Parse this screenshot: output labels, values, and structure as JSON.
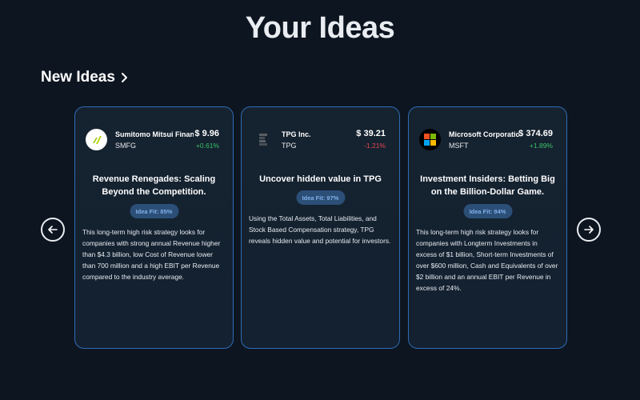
{
  "page": {
    "title": "Your Ideas"
  },
  "section": {
    "title": "New Ideas"
  },
  "colors": {
    "background": "#0d1520",
    "card_border": "#2e6cb5",
    "positive": "#3cc36a",
    "negative": "#e5484d",
    "badge_bg": "#2c4f78",
    "badge_text": "#7fb0e8"
  },
  "icons": {
    "section_chevron": "chevron-right-icon",
    "prev": "arrow-left-icon",
    "next": "arrow-right-icon"
  },
  "cards": [
    {
      "company": "Sumitomo Mitsui Financ",
      "ticker": "SMFG",
      "price": "$ 9.96",
      "change": "+0.61%",
      "change_direction": "up",
      "logo": "smfg-logo-icon",
      "title": "Revenue Renegades: Scaling Beyond the Competition.",
      "fit": "Idea Fit: 85%",
      "description": "This long-term high risk strategy looks for companies with strong annual Revenue higher than $4.3 billion, low Cost of Revenue lower than 700 million and a high EBIT per Revenue compared to the industry average."
    },
    {
      "company": "TPG Inc.",
      "ticker": "TPG",
      "price": "$ 39.21",
      "change": "-1.21%",
      "change_direction": "down",
      "logo": "tpg-logo-icon",
      "title": "Uncover hidden value in TPG",
      "fit": "Idea Fit: 97%",
      "description": "Using the Total Assets, Total Liabilities, and Stock Based Compensation strategy, TPG reveals hidden value and potential for investors."
    },
    {
      "company": "Microsoft Corporatic",
      "ticker": "MSFT",
      "price": "$ 374.69",
      "change": "+1.89%",
      "change_direction": "up",
      "logo": "microsoft-logo-icon",
      "title": "Investment Insiders: Betting Big on the Billion-Dollar Game.",
      "fit": "Idea Fit: 94%",
      "description": "This long-term high risk strategy looks for companies with Longterm Investments in excess of $1 billion, Short-term Investments of over $600 million, Cash and Equivalents of over $2 billion and an annual EBIT per Revenue in excess of 24%."
    }
  ]
}
